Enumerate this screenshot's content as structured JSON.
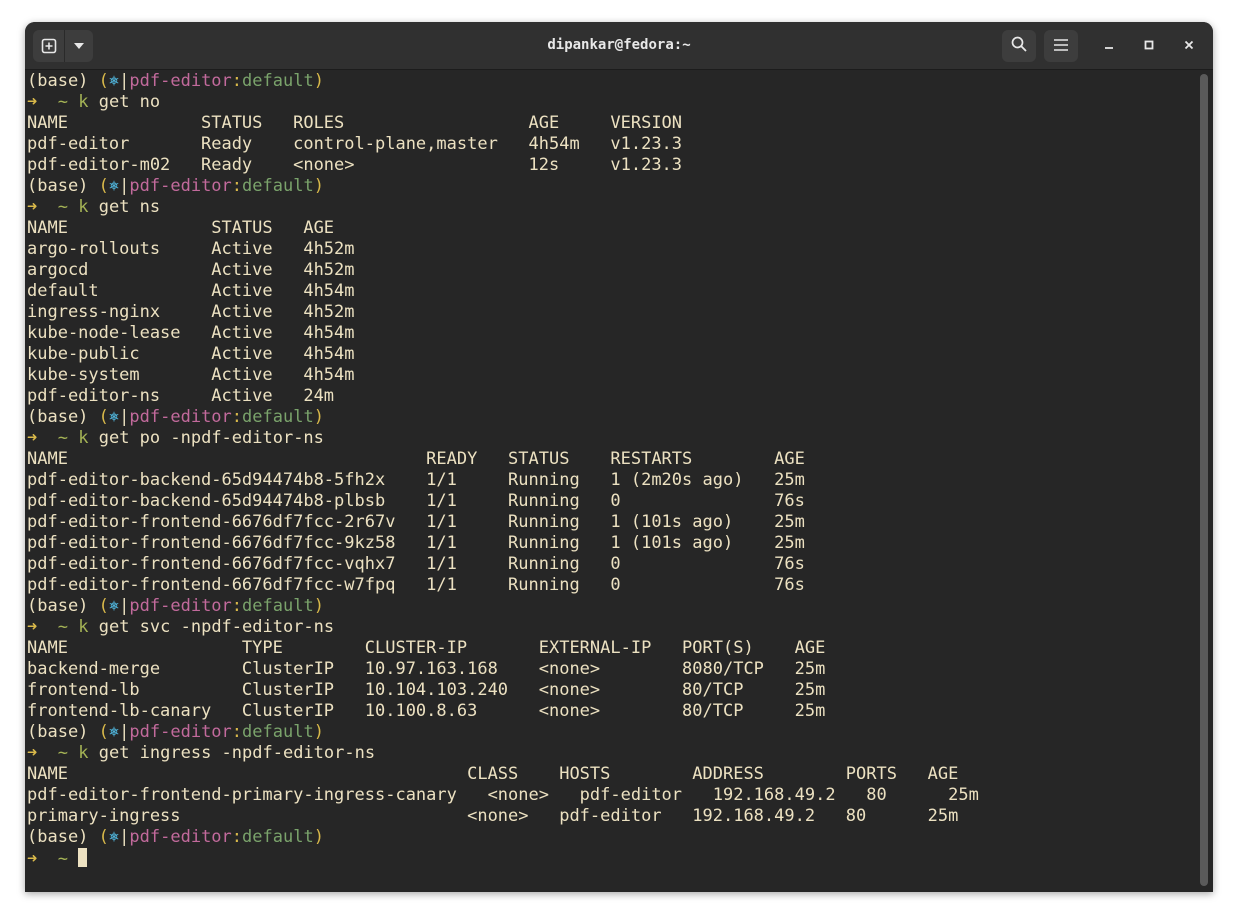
{
  "window": {
    "title": "dipankar@fedora:~"
  },
  "prompt": {
    "base": "(base)",
    "open": "(",
    "k8s_symbol": "⎈",
    "sep": "|",
    "context": "pdf-editor",
    "colon": ":",
    "namespace": "default",
    "close": ")",
    "arrow": "➜",
    "tilde": "~",
    "k_symbol": "k"
  },
  "commands": {
    "c1": "get no",
    "c2": "get ns",
    "c3": "get po -npdf-editor-ns",
    "c4": "get svc -npdf-editor-ns",
    "c5": "get ingress -npdf-editor-ns"
  },
  "nodes": [
    "NAME             STATUS   ROLES                  AGE     VERSION",
    "pdf-editor       Ready    control-plane,master   4h54m   v1.23.3",
    "pdf-editor-m02   Ready    <none>                 12s     v1.23.3"
  ],
  "namespaces": [
    "NAME              STATUS   AGE",
    "argo-rollouts     Active   4h52m",
    "argocd            Active   4h52m",
    "default           Active   4h54m",
    "ingress-nginx     Active   4h52m",
    "kube-node-lease   Active   4h54m",
    "kube-public       Active   4h54m",
    "kube-system       Active   4h54m",
    "pdf-editor-ns     Active   24m"
  ],
  "pods": [
    "NAME                                   READY   STATUS    RESTARTS        AGE",
    "pdf-editor-backend-65d94474b8-5fh2x    1/1     Running   1 (2m20s ago)   25m",
    "pdf-editor-backend-65d94474b8-plbsb    1/1     Running   0               76s",
    "pdf-editor-frontend-6676df7fcc-2r67v   1/1     Running   1 (101s ago)    25m",
    "pdf-editor-frontend-6676df7fcc-9kz58   1/1     Running   1 (101s ago)    25m",
    "pdf-editor-frontend-6676df7fcc-vqhx7   1/1     Running   0               76s",
    "pdf-editor-frontend-6676df7fcc-w7fpq   1/1     Running   0               76s"
  ],
  "services": [
    "NAME                 TYPE        CLUSTER-IP       EXTERNAL-IP   PORT(S)    AGE",
    "backend-merge        ClusterIP   10.97.163.168    <none>        8080/TCP   25m",
    "frontend-lb          ClusterIP   10.104.103.240   <none>        80/TCP     25m",
    "frontend-lb-canary   ClusterIP   10.100.8.63      <none>        80/TCP     25m"
  ],
  "ingresses": [
    "NAME                                       CLASS    HOSTS        ADDRESS        PORTS   AGE",
    "pdf-editor-frontend-primary-ingress-canary   <none>   pdf-editor   192.168.49.2   80      25m",
    "primary-ingress                            <none>   pdf-editor   192.168.49.2   80      25m"
  ]
}
